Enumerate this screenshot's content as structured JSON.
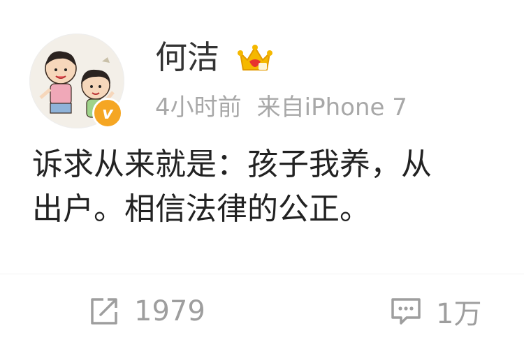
{
  "post": {
    "username": "何洁",
    "timestamp": "4小时前",
    "source": "来自iPhone 7",
    "verified_badge_letter": "v",
    "content_lines": [
      "诉求从来就是：孩子我养，从",
      "出户。相信法律的公正。"
    ]
  },
  "actions": {
    "repost_count": "1979",
    "comment_count": "1万"
  },
  "icons": {
    "avatar": "cartoon-kids-avatar",
    "verified": "verified-v-badge",
    "member": "crown-member-icon",
    "repost": "repost-edit-icon",
    "comment": "comment-bubble-icon"
  },
  "colors": {
    "verified_badge": "#f5a623",
    "member_crown": "#f5b800",
    "meta_text": "#a8a8a8",
    "action_text": "#9e9e9e"
  }
}
